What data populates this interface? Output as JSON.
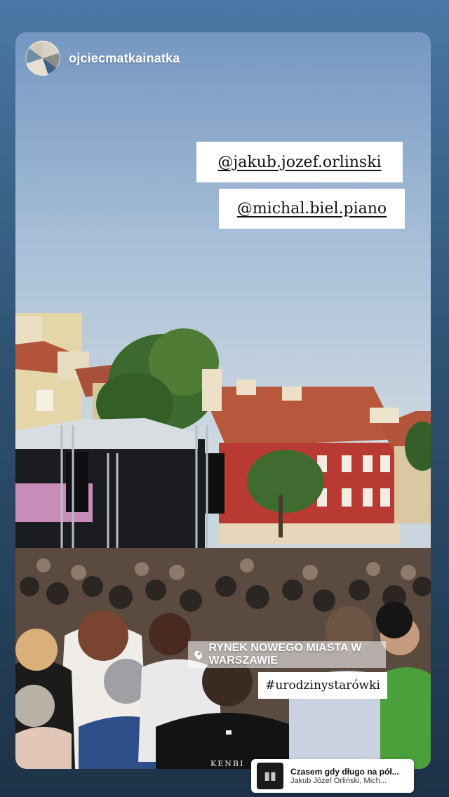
{
  "story": {
    "username": "ojciecmatkainatka",
    "mentions": [
      "@jakub.jozef.orlinski",
      "@michal.biel.piano"
    ],
    "location": "RYNEK NOWEGO MIASTA W WARSZAWIE",
    "hashtag": "#urodzinystarówki",
    "photo_banner_text": "KENBI"
  },
  "music": {
    "song": "Czasem gdy długo na pół...",
    "artist": "Jakub Józef Orliński, Mich..."
  },
  "colors": {
    "page_bg_top": "#4a78a6",
    "page_bg_bottom": "#1d3247",
    "roof": "#b2553a",
    "building_red": "#b83a33",
    "tree": "#3c6a2e"
  }
}
